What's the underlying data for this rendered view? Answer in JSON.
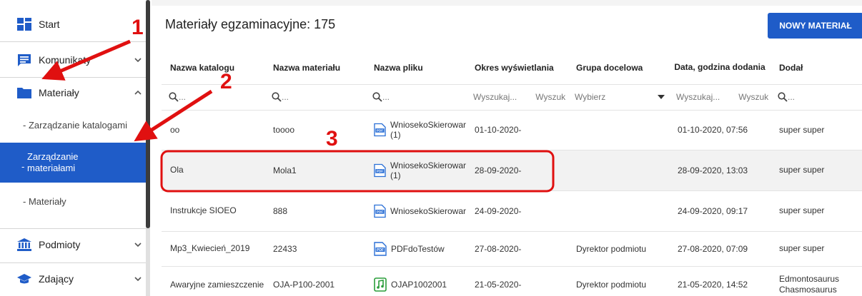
{
  "sidebar": {
    "items": [
      {
        "label": "Start",
        "icon": "dashboard-icon"
      },
      {
        "label": "Komunikaty",
        "icon": "message-icon"
      },
      {
        "label": "Materiały",
        "icon": "folder-icon"
      },
      {
        "label": "Podmioty",
        "icon": "institution-icon"
      },
      {
        "label": "Zdający",
        "icon": "graduation-cap-icon"
      }
    ],
    "sub_items": [
      {
        "label": "- Zarządzanie katalogami"
      },
      {
        "label_line1": "Zarządzanie",
        "label_line2": "materiałami",
        "prefix": "-"
      },
      {
        "label": "- Materiały"
      }
    ]
  },
  "main": {
    "title": "Materiały egzaminacyjne: 175",
    "new_button": "NOWY MATERIAŁ",
    "columns": [
      "Nazwa katalogu",
      "Nazwa materiału",
      "Nazwa pliku",
      "Okres wyświetlania",
      "Grupa docelowa",
      "Data, godzina dodania",
      "Dodał"
    ],
    "filters": {
      "ellipsis": "...",
      "search_placeholder": "Wyszukaj...",
      "search_short": "Wyszuk",
      "select_placeholder": "Wybierz"
    },
    "rows": [
      {
        "catalog": "oo",
        "material": "toooo",
        "file_line1": "WniosekoSkierowar",
        "file_line2": "(1)",
        "file_type": "pdf",
        "period": "01-10-2020-",
        "group": "",
        "added": "01-10-2020, 07:56",
        "by_line1": "super super",
        "by_line2": ""
      },
      {
        "catalog": "Ola",
        "material": "Mola1",
        "file_line1": "WniosekoSkierowar",
        "file_line2": "(1)",
        "file_type": "pdf",
        "period": "28-09-2020-",
        "group": "",
        "added": "28-09-2020, 13:03",
        "by_line1": "super super",
        "by_line2": ""
      },
      {
        "catalog": "Instrukcje SIOEO",
        "material": "888",
        "file_line1": "WniosekoSkierowar",
        "file_line2": "",
        "file_type": "pdf",
        "period": "24-09-2020-",
        "group": "",
        "added": "24-09-2020, 09:17",
        "by_line1": "super super",
        "by_line2": ""
      },
      {
        "catalog": "Mp3_Kwiecień_2019",
        "material": "22433",
        "file_line1": "PDFdoTestów",
        "file_line2": "",
        "file_type": "pdf",
        "period": "27-08-2020-",
        "group": "Dyrektor podmiotu",
        "added": "27-08-2020, 07:09",
        "by_line1": "super super",
        "by_line2": ""
      },
      {
        "catalog": "Awaryjne zamieszczenie",
        "material": "OJA-P100-2001",
        "file_line1": "OJAP1002001",
        "file_line2": "",
        "file_type": "audio",
        "period": "21-05-2020-",
        "group": "Dyrektor podmiotu",
        "added": "21-05-2020, 14:52",
        "by_line1": "Edmontosaurus",
        "by_line2": "Chasmosaurus"
      }
    ]
  },
  "annotations": {
    "n1": "1",
    "n2": "2",
    "n3": "3"
  },
  "colors": {
    "accent": "#1f5cc8",
    "annotation": "#e01010",
    "audio_icon": "#2a9d3a"
  }
}
